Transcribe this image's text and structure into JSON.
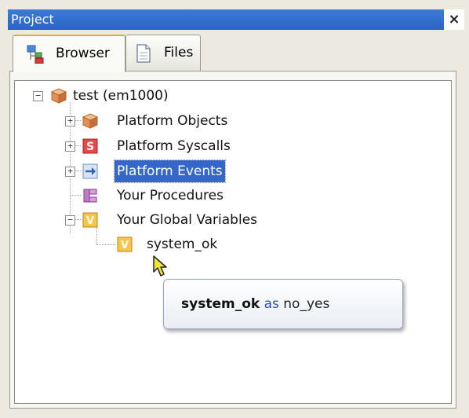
{
  "panel": {
    "title": "Project",
    "close_glyph": "×"
  },
  "tabs": [
    {
      "label": "Browser",
      "icon": "project-browser-icon",
      "active": true
    },
    {
      "label": "Files",
      "icon": "file-icon",
      "active": false
    }
  ],
  "tree": {
    "root": {
      "label": "test (em1000)",
      "icon": "cube-icon",
      "expander": "−"
    },
    "children": [
      {
        "label": "Platform Objects",
        "icon": "cube-icon",
        "expander": "+"
      },
      {
        "label": "Platform Syscalls",
        "icon": "syscall-s-icon",
        "expander": "+"
      },
      {
        "label": "Platform Events",
        "icon": "event-arrow-icon",
        "expander": "+",
        "selected": true
      },
      {
        "label": "Your Procedures",
        "icon": "procedure-icon"
      },
      {
        "label": "Your Global Variables",
        "icon": "variable-v-icon",
        "expander": "−"
      }
    ],
    "variable": {
      "label": "system_ok",
      "icon": "variable-v-icon"
    }
  },
  "tooltip": {
    "var_name": "system_ok",
    "keyword": "as",
    "type": "no_yes"
  },
  "colors": {
    "title_bar": "#2a63c5",
    "selection": "#3467c8",
    "tab_accent": "#e6a93b"
  }
}
